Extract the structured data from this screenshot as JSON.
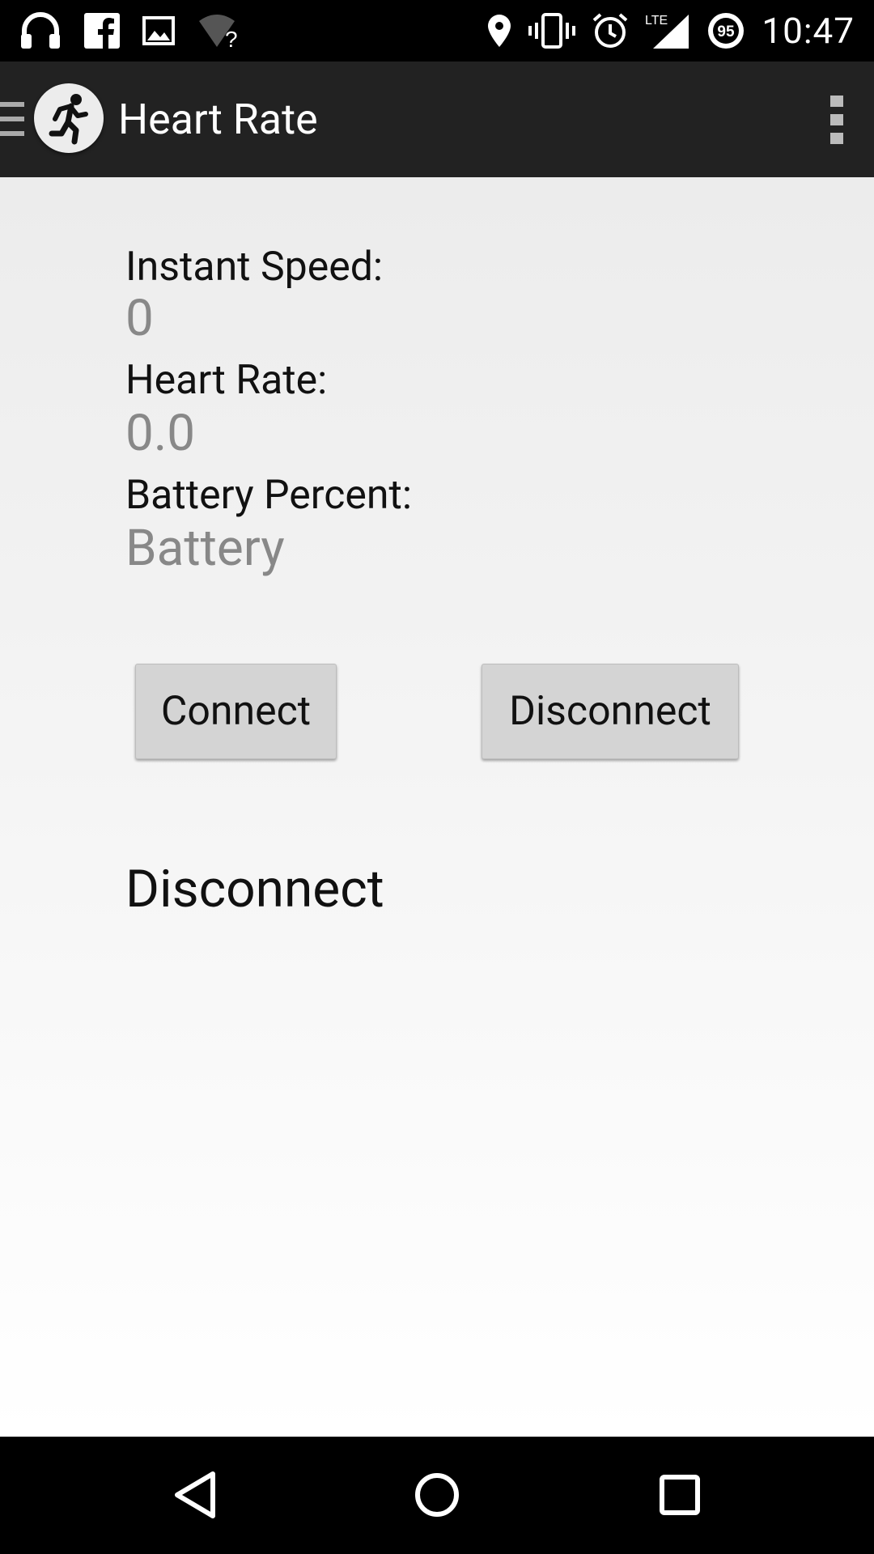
{
  "status_bar": {
    "time": "10:47",
    "battery_level": "95",
    "network_type": "LTE",
    "wifi_status": "?",
    "icons_left": [
      "headphones-icon",
      "facebook-icon",
      "image-icon",
      "wifi-unknown-icon"
    ],
    "icons_right": [
      "location-icon",
      "vibrate-icon",
      "alarm-icon",
      "lte-signal-icon",
      "battery-icon"
    ]
  },
  "action_bar": {
    "title": "Heart Rate",
    "app_icon": "running-person-icon"
  },
  "metrics": {
    "instant_speed_label": "Instant Speed:",
    "instant_speed_value": "0",
    "heart_rate_label": "Heart Rate:",
    "heart_rate_value": "0.0",
    "battery_label": "Battery Percent:",
    "battery_value": "Battery"
  },
  "buttons": {
    "connect_label": "Connect",
    "disconnect_label": "Disconnect"
  },
  "connection_status": "Disconnect",
  "colors": {
    "status_bar_bg": "#000000",
    "action_bar_bg": "#222222",
    "value_text": "#888888",
    "button_bg": "#d4d4d4"
  }
}
